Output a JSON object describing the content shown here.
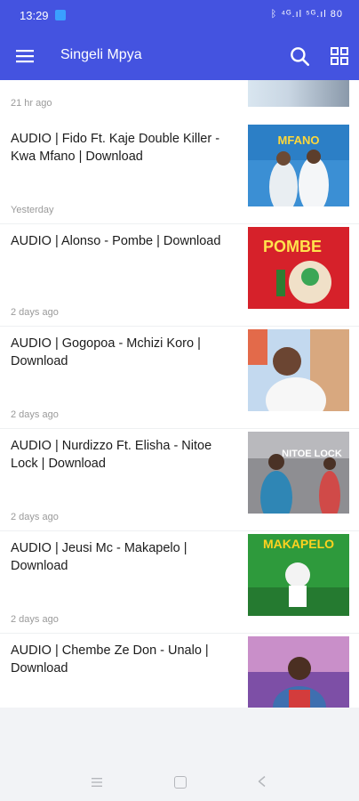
{
  "status_bar": {
    "time": "13:29",
    "right_icons": "ᛒ ⁴ᴳ.ıl ⁵ᴳ.ıl 80"
  },
  "app_bar": {
    "title": "Singeli Mpya"
  },
  "partial_item": {
    "time": "21 hr ago"
  },
  "items": [
    {
      "title": "AUDIO | Fido Ft. Kaje Double Killer - Kwa Mfano | Download",
      "time": "Yesterday",
      "thumb_text": "MFANO",
      "thumb_bg": "#2c7fc6"
    },
    {
      "title": "AUDIO | Alonso - Pombe | Download",
      "time": "2 days ago",
      "thumb_text": "POMBE",
      "thumb_bg": "#d6212a"
    },
    {
      "title": "AUDIO | Gogopoa - Mchizi Koro | Download",
      "time": "2 days ago",
      "thumb_text": "",
      "thumb_bg": "#6ea4d6"
    },
    {
      "title": "AUDIO | Nurdizzo Ft. Elisha - Nitoe Lock | Download",
      "time": "2 days ago",
      "thumb_text": "NITOE LOCK",
      "thumb_bg": "#8e8e92"
    },
    {
      "title": "AUDIO | Jeusi Mc - Makapelo | Download",
      "time": "2 days ago",
      "thumb_text": "MAKAPELO",
      "thumb_bg": "#2e9a3c"
    },
    {
      "title": "AUDIO | Chembe Ze Don - Unalo | Download",
      "time": "",
      "thumb_text": "",
      "thumb_bg": "#7d4fa6"
    }
  ]
}
